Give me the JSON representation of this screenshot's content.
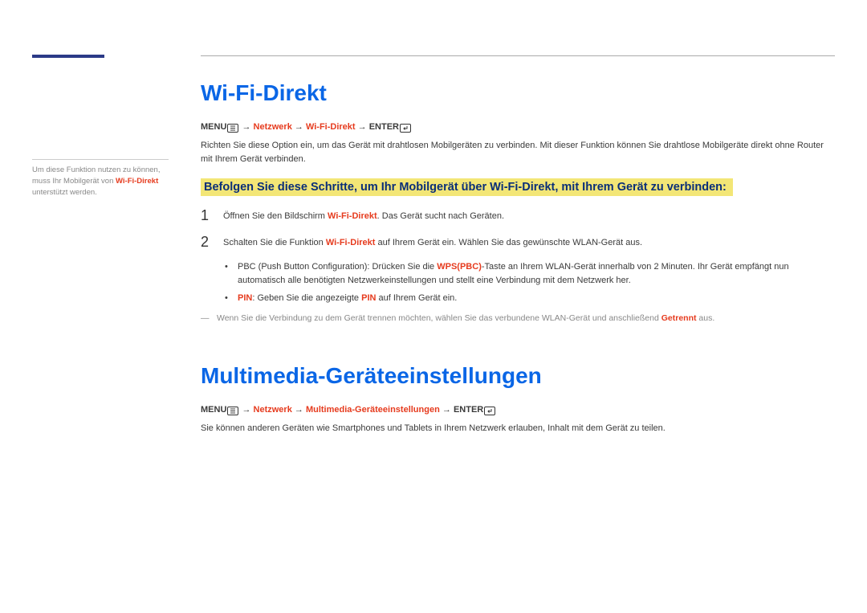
{
  "sidebar": {
    "pre": "Um diese Funktion nutzen zu können, muss Ihr Mobilgerät von ",
    "hl": "Wi-Fi-Direkt",
    "post": " unterstützt werden."
  },
  "section1": {
    "title": "Wi-Fi-Direkt",
    "crumb": {
      "menu": "MENU",
      "c1": "Netzwerk",
      "c2": "Wi-Fi-Direkt",
      "enter": "ENTER",
      "arrow": " → "
    },
    "intro": "Richten Sie diese Option ein, um das Gerät mit drahtlosen Mobilgeräten zu verbinden. Mit dieser Funktion können Sie drahtlose Mobilgeräte direkt ohne Router mit Ihrem Gerät verbinden.",
    "highlight": "Befolgen Sie diese Schritte, um Ihr Mobilgerät über Wi-Fi-Direkt, mit Ihrem Gerät zu verbinden:",
    "step1": {
      "num": "1",
      "pre": "Öffnen Sie den Bildschirm ",
      "hl": "Wi-Fi-Direkt",
      "post": ". Das Gerät sucht nach Geräten."
    },
    "step2": {
      "num": "2",
      "pre": "Schalten Sie die Funktion ",
      "hl": "Wi-Fi-Direkt",
      "post": " auf Ihrem Gerät ein. Wählen Sie das gewünschte WLAN-Gerät aus."
    },
    "bullet1": {
      "pre": "PBC (Push Button Configuration): Drücken Sie die ",
      "hl": "WPS(PBC)",
      "post": "-Taste an Ihrem WLAN-Gerät innerhalb von 2 Minuten. Ihr Gerät empfängt nun automatisch alle benötigten Netzwerkeinstellungen und stellt eine Verbindung mit dem Netzwerk her."
    },
    "bullet2": {
      "hl1": "PIN",
      "mid": ": Geben Sie die angezeigte ",
      "hl2": "PIN",
      "post": " auf Ihrem Gerät ein."
    },
    "footnote": {
      "pre": "Wenn Sie die Verbindung zu dem Gerät trennen möchten, wählen Sie das verbundene WLAN-Gerät und anschließend ",
      "hl": "Getrennt",
      "post": " aus."
    }
  },
  "section2": {
    "title": "Multimedia-Geräteeinstellungen",
    "crumb": {
      "menu": "MENU",
      "c1": "Netzwerk",
      "c2": "Multimedia-Geräteeinstellungen",
      "enter": "ENTER",
      "arrow": " → "
    },
    "body": "Sie können anderen Geräten wie Smartphones und Tablets in Ihrem Netzwerk erlauben, Inhalt mit dem Gerät zu teilen."
  }
}
